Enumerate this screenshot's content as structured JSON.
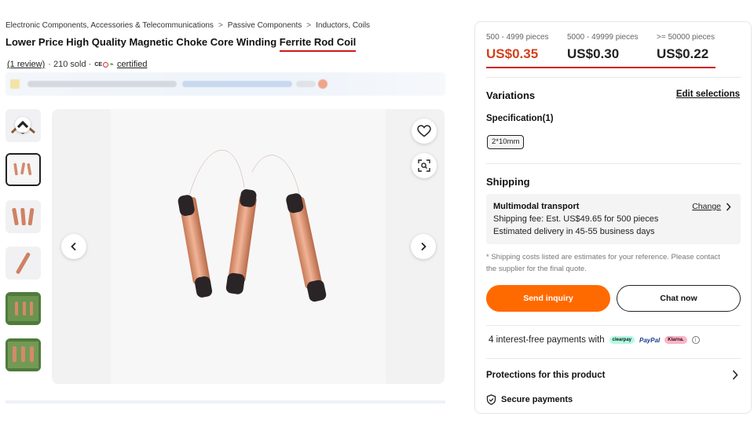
{
  "breadcrumb": [
    "Electronic Components, Accessories & Telecommunications",
    "Passive Components",
    "Inductors, Coils"
  ],
  "product": {
    "title_prefix": "Lower Price High Quality Magnetic Choke Core Winding ",
    "title_highlight": "Ferrite Rod Coil",
    "reviews": "(1 review)",
    "sold": "· 210 sold ·",
    "certified": "certified"
  },
  "gallery": {
    "thumbnail_count": 6,
    "active_thumbnail": 2
  },
  "pricing": {
    "tiers": [
      {
        "quantity": "500 - 4999 pieces",
        "price": "US$0.35"
      },
      {
        "quantity": "5000 - 49999 pieces",
        "price": "US$0.30"
      },
      {
        "quantity": ">= 50000 pieces",
        "price": "US$0.22"
      }
    ],
    "accent_color": "#d0421b"
  },
  "variations": {
    "title": "Variations",
    "edit_label": "Edit selections",
    "spec_label": "Specification(1)",
    "spec_value": "2*10mm"
  },
  "shipping": {
    "title": "Shipping",
    "method": "Multimodal transport",
    "change_label": "Change",
    "fee": "Shipping fee: Est. US$49.65 for 500 pieces",
    "delivery": "Estimated delivery in 45-55 business days",
    "note": "* Shipping costs listed are estimates for your reference. Please contact the supplier for the final quote."
  },
  "actions": {
    "inquiry_label": "Send inquiry",
    "chat_label": "Chat now",
    "primary_color": "#ff6a00"
  },
  "payments": {
    "label": "4 interest-free payments with",
    "providers": [
      "clearpay",
      "PayPal",
      "Klarna."
    ]
  },
  "protections": {
    "title": "Protections for this product",
    "secure_label": "Secure payments"
  }
}
